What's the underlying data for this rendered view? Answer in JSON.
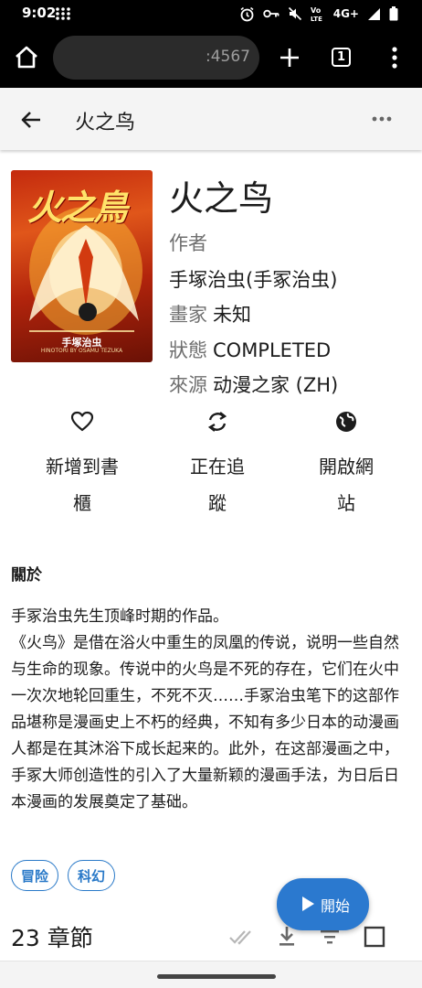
{
  "status_bar": {
    "time": "9:02",
    "network_label": "4G+",
    "icons": [
      "grid-icon",
      "alarm-icon",
      "key-icon",
      "mute-icon",
      "volte-icon",
      "signal-icon",
      "battery-icon"
    ]
  },
  "browser": {
    "url_suffix": ":4567",
    "tab_count": "1"
  },
  "app_bar": {
    "title": "火之鸟"
  },
  "manga": {
    "title": "火之鸟",
    "author_label": "作者",
    "author_value": "手塚治虫(手冢治虫)",
    "artist_label": "畫家",
    "artist_value": "未知",
    "status_label": "狀態",
    "status_value": "COMPLETED",
    "source_label": "來源",
    "source_value": "动漫之家 (ZH)",
    "cover": {
      "title_text": "火之鳥",
      "author_text": "手塚治虫",
      "subtitle_text": "HINOTORI BY OSAMU TEZUKA"
    }
  },
  "actions": {
    "library_line1": "新增到書",
    "library_line2": "櫃",
    "tracking_line1": "正在追",
    "tracking_line2": "蹤",
    "webview_line1": "開啟網",
    "webview_line2": "站"
  },
  "about": {
    "heading": "關於",
    "description": "手冢治虫先生顶峰时期的作品。\n《火鸟》是借在浴火中重生的凤凰的传说，说明一些自然与生命的现象。传说中的火鸟是不死的存在，它们在火中一次次地轮回重生，不死不灭……手冢治虫笔下的这部作品堪称是漫画史上不朽的经典，不知有多少日本的动漫画人都是在其沐浴下成长起来的。此外，在这部漫画之中，手冢大师创造性的引入了大量新颖的漫画手法，为日后日本漫画的发展奠定了基础。"
  },
  "genres": [
    "冒险",
    "科幻"
  ],
  "chapters": {
    "count_label": "23 章節"
  },
  "fab": {
    "label": "開始"
  },
  "colors": {
    "accent": "#2b79cf",
    "status_bar": "#000000",
    "app_bar": "#f4f4f4"
  }
}
